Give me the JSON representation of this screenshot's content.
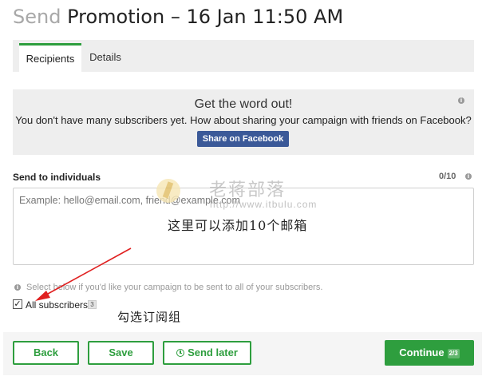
{
  "header": {
    "prefix": "Send",
    "title": "Promotion – 16 Jan 11:50 AM"
  },
  "tabs": [
    {
      "label": "Recipients",
      "active": true
    },
    {
      "label": "Details",
      "active": false
    }
  ],
  "promo": {
    "title": "Get the word out!",
    "text": "You don't have many subscribers yet. How about sharing your campaign with friends on Facebook?",
    "button": "Share on Facebook",
    "button_color": "#3b5998"
  },
  "individuals": {
    "label": "Send to individuals",
    "counter": "0/10",
    "placeholder": "Example: hello@email.com, friend@example.com"
  },
  "subscribers": {
    "hint": "Select below if you'd like your campaign to be sent to all of your subscribers.",
    "checkbox_label": "All subscribers",
    "checked": true,
    "count": "3"
  },
  "footer": {
    "back": "Back",
    "save": "Save",
    "send_later": "Send later",
    "continue": "Continue",
    "step": "2/3"
  },
  "annotations": {
    "watermark_text": "老蒋部落",
    "watermark_url": "http://www.itbulu.com",
    "note_email": "这里可以添加10个邮箱",
    "note_check": "勾选订阅组"
  },
  "colors": {
    "accent": "#2e9e3e",
    "facebook": "#3b5998",
    "arrow": "#e02020"
  }
}
